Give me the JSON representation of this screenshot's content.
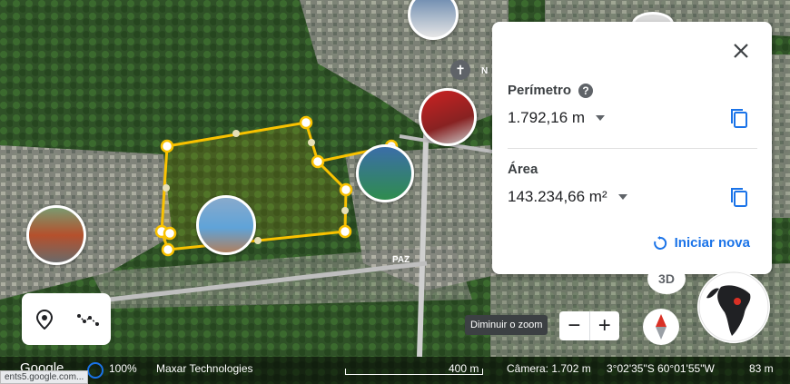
{
  "measure_panel": {
    "perimeter_label": "Perímetro",
    "perimeter_help": "?",
    "perimeter_value": "1.792,16 m",
    "area_label": "Área",
    "area_value": "143.234,66 m²",
    "reset_label": "Iniciar nova"
  },
  "map": {
    "road_label": "PAZ",
    "pin_letter": "N"
  },
  "controls": {
    "zoom_out": "−",
    "zoom_in": "+",
    "zoom_tooltip": "Diminuir o zoom",
    "view_3d": "3D"
  },
  "bottom_bar": {
    "logo": "Google",
    "percent": "100%",
    "imagery": "Maxar Technologies",
    "scale": "400 m",
    "camera": "Câmera: 1.702 m",
    "coords": "3°02'35\"S 60°01'55\"W",
    "elevation": "83 m"
  },
  "status_url": "ents5.google.com...",
  "colors": {
    "accent": "#1a73e8",
    "polygon": "#f9c200",
    "panel_bg": "#ffffff"
  },
  "icons": [
    "close-icon",
    "help-icon",
    "copy-icon",
    "reset-icon",
    "place-pin-icon",
    "path-icon",
    "compass-icon",
    "globe-icon"
  ]
}
